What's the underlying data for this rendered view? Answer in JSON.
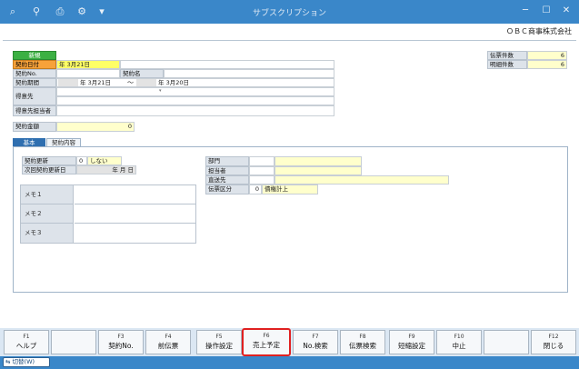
{
  "window": {
    "title": "サブスクリプション",
    "controls": [
      "minimize-icon",
      "maximize-icon",
      "close-icon"
    ],
    "toolbar_icons": [
      "search-add-icon",
      "zoom-icon",
      "print-icon",
      "settings-icon",
      "dropdown-icon"
    ]
  },
  "company": "ＯＢＣ商事株式会社",
  "header": {
    "status_badge": "新規",
    "contract_date_label": "契約日付",
    "contract_date_value": "年  3月21日",
    "contract_no_label": "契約No.",
    "contract_name_label": "契約名",
    "contract_period_label": "契約期間",
    "period_from": "年  3月21日",
    "period_sep": "～",
    "period_to": "年  3月20日",
    "customer_label": "得意先",
    "customer_person_label": "得意先担当者",
    "amount_label": "契約金額",
    "amount_value": "0"
  },
  "counts": {
    "slip_count_label": "伝票件数",
    "slip_count_value": "6",
    "detail_count_label": "明細件数",
    "detail_count_value": "6"
  },
  "tabs": [
    {
      "label": "基本",
      "active": true
    },
    {
      "label": "契約内容",
      "active": false
    }
  ],
  "basic": {
    "renewal_label": "契約更新",
    "renewal_code": "0",
    "renewal_value": "しない",
    "next_renewal_label": "次回契約更新日",
    "next_renewal_value": "年    月    日",
    "memo1": "メモ１",
    "memo2": "メモ２",
    "memo3": "メモ３",
    "dept_label": "部門",
    "staff_label": "担当者",
    "ship_label": "直送先",
    "slip_type_label": "伝票区分",
    "slip_type_code": "0",
    "slip_type_value": "債権計上"
  },
  "fkeys": [
    {
      "key": "F1",
      "label": "ヘルプ"
    },
    {
      "key": "",
      "label": ""
    },
    {
      "key": "F3",
      "label": "契約No."
    },
    {
      "key": "F4",
      "label": "前伝票"
    },
    {
      "key": "F5",
      "label": "操作設定"
    },
    {
      "key": "F6",
      "label": "売上予定",
      "highlight": true
    },
    {
      "key": "F7",
      "label": "No.検索"
    },
    {
      "key": "F8",
      "label": "伝票検索"
    },
    {
      "key": "F9",
      "label": "短縮設定"
    },
    {
      "key": "F10",
      "label": "中止"
    },
    {
      "key": "",
      "label": ""
    },
    {
      "key": "F12",
      "label": "閉じる"
    }
  ],
  "status": {
    "switch_label": "切替(W)"
  },
  "colors": {
    "titlebar": "#3a87c9",
    "highlight_border": "#e02020",
    "required_label": "#f7a23a",
    "new_badge": "#3cb043"
  }
}
